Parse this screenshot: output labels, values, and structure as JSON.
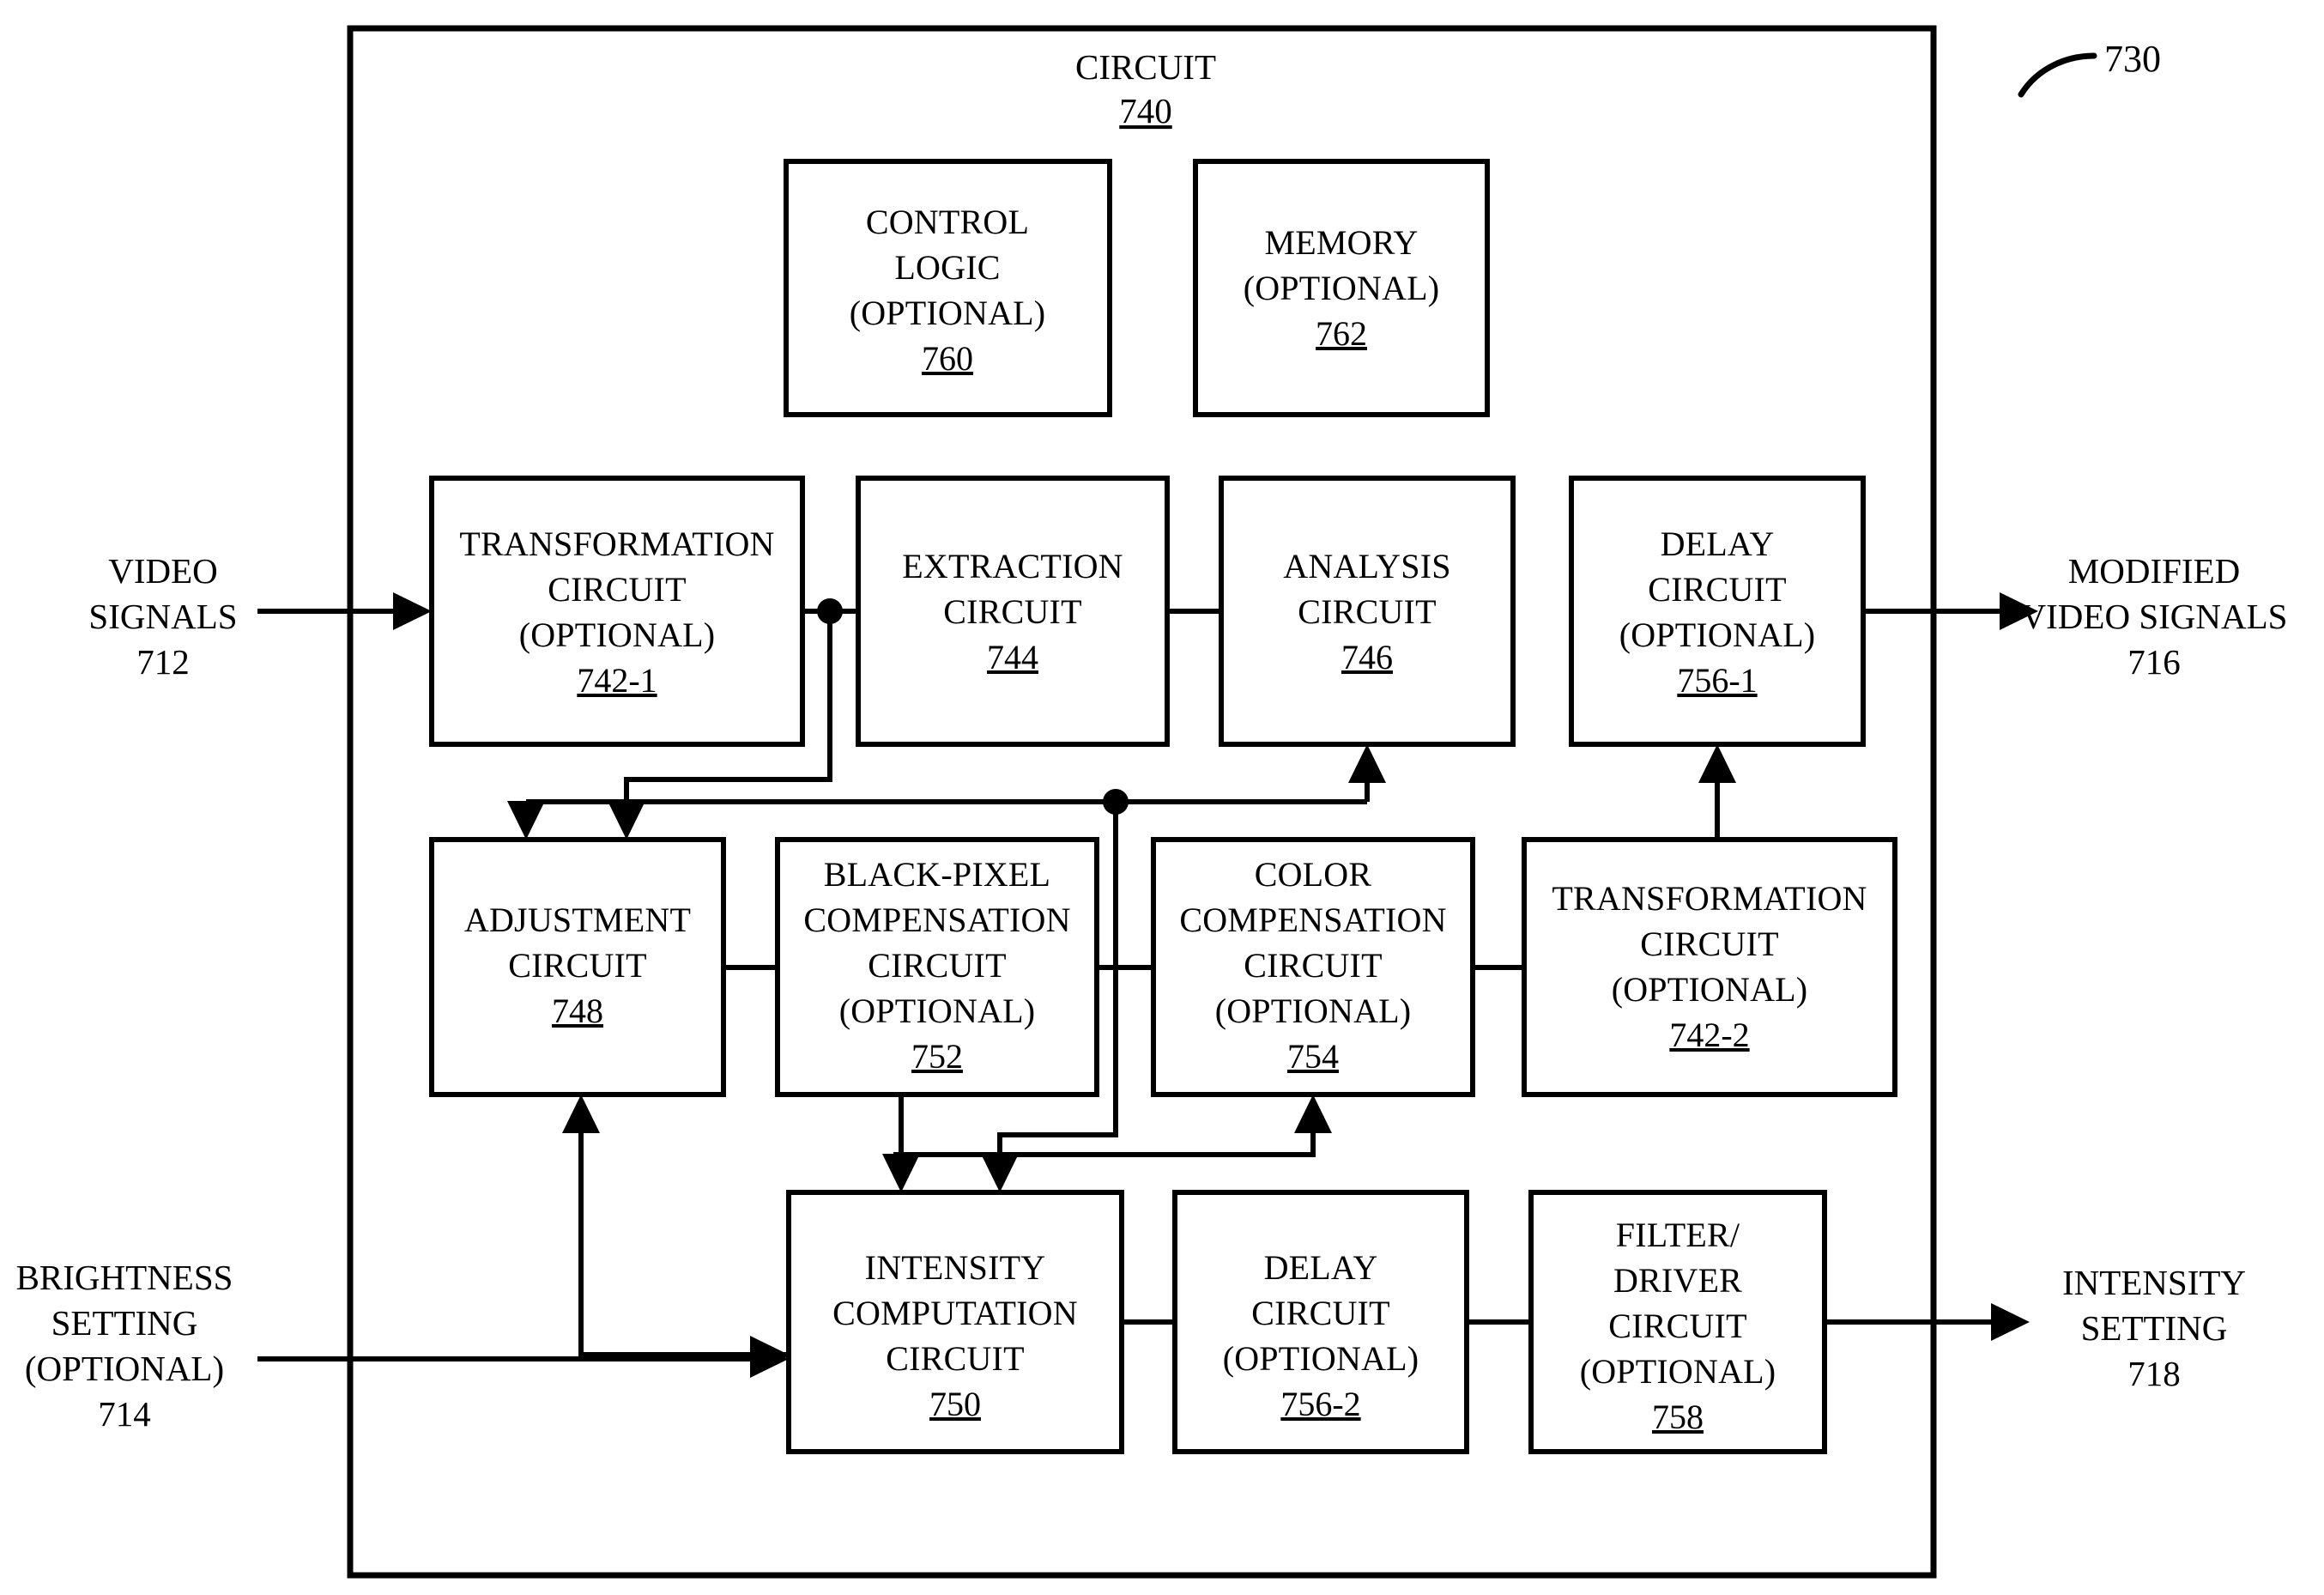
{
  "figure": {
    "reference_numeral": "730",
    "container": {
      "title": "CIRCUIT",
      "number": "740"
    }
  },
  "inputs": [
    {
      "id": "video-signals",
      "lines": [
        "VIDEO",
        "SIGNALS"
      ],
      "number": "712"
    },
    {
      "id": "brightness-setting",
      "lines": [
        "BRIGHTNESS",
        "SETTING",
        "(OPTIONAL)"
      ],
      "number": "714"
    }
  ],
  "outputs": [
    {
      "id": "modified-video-signals",
      "lines": [
        "MODIFIED",
        "VIDEO SIGNALS"
      ],
      "number": "716"
    },
    {
      "id": "intensity-setting",
      "lines": [
        "INTENSITY",
        "SETTING"
      ],
      "number": "718"
    }
  ],
  "blocks": [
    {
      "id": "control-logic",
      "lines": [
        "CONTROL",
        "LOGIC",
        "(OPTIONAL)"
      ],
      "number": "760"
    },
    {
      "id": "memory",
      "lines": [
        "MEMORY",
        "(OPTIONAL)"
      ],
      "number": "762"
    },
    {
      "id": "transformation-circuit-1",
      "lines": [
        "TRANSFORMATION",
        "CIRCUIT",
        "(OPTIONAL)"
      ],
      "number": "742-1"
    },
    {
      "id": "extraction-circuit",
      "lines": [
        "EXTRACTION",
        "CIRCUIT"
      ],
      "number": "744"
    },
    {
      "id": "analysis-circuit",
      "lines": [
        "ANALYSIS",
        "CIRCUIT"
      ],
      "number": "746"
    },
    {
      "id": "delay-circuit-1",
      "lines": [
        "DELAY",
        "CIRCUIT",
        "(OPTIONAL)"
      ],
      "number": "756-1"
    },
    {
      "id": "adjustment-circuit",
      "lines": [
        "ADJUSTMENT",
        "CIRCUIT"
      ],
      "number": "748"
    },
    {
      "id": "black-pixel-compensation-circuit",
      "lines": [
        "BLACK-PIXEL",
        "COMPENSATION",
        "CIRCUIT",
        "(OPTIONAL)"
      ],
      "number": "752"
    },
    {
      "id": "color-compensation-circuit",
      "lines": [
        "COLOR",
        "COMPENSATION",
        "CIRCUIT",
        "(OPTIONAL)"
      ],
      "number": "754"
    },
    {
      "id": "transformation-circuit-2",
      "lines": [
        "TRANSFORMATION",
        "CIRCUIT",
        "(OPTIONAL)"
      ],
      "number": "742-2"
    },
    {
      "id": "intensity-computation-circuit",
      "lines": [
        "INTENSITY",
        "COMPUTATION",
        "CIRCUIT"
      ],
      "number": "750"
    },
    {
      "id": "delay-circuit-2",
      "lines": [
        "DELAY",
        "CIRCUIT",
        "(OPTIONAL)"
      ],
      "number": "756-2"
    },
    {
      "id": "filter-driver-circuit",
      "lines": [
        "FILTER/",
        "DRIVER",
        "CIRCUIT",
        "(OPTIONAL)"
      ],
      "number": "758"
    }
  ]
}
